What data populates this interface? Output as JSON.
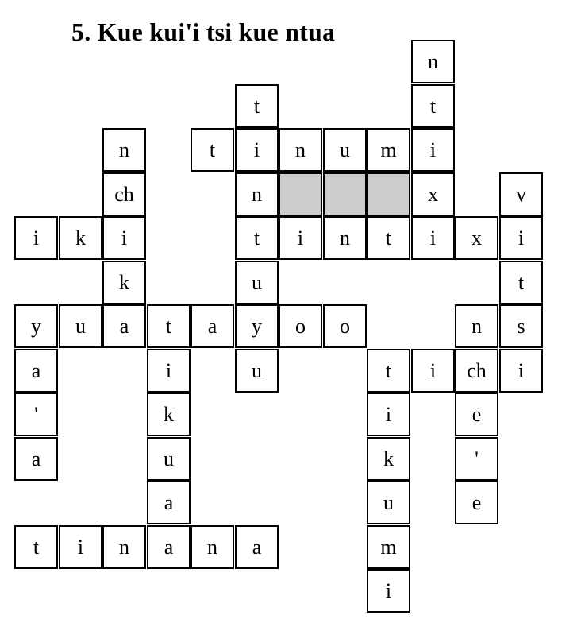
{
  "title": "5.  Kue kui'i tsi kue ntua",
  "colors": {
    "border": "#000000",
    "shaded_cell": "#cccccc",
    "background": "#ffffff"
  },
  "grid": {
    "rows": 13,
    "cols": 12,
    "cells": [
      {
        "r": 0,
        "c": 9,
        "letter": "n"
      },
      {
        "r": 1,
        "c": 5,
        "letter": "t"
      },
      {
        "r": 1,
        "c": 9,
        "letter": "t"
      },
      {
        "r": 2,
        "c": 2,
        "letter": "n"
      },
      {
        "r": 2,
        "c": 4,
        "letter": "t"
      },
      {
        "r": 2,
        "c": 5,
        "letter": "i"
      },
      {
        "r": 2,
        "c": 6,
        "letter": "n"
      },
      {
        "r": 2,
        "c": 7,
        "letter": "u"
      },
      {
        "r": 2,
        "c": 8,
        "letter": "m"
      },
      {
        "r": 2,
        "c": 9,
        "letter": "i"
      },
      {
        "r": 3,
        "c": 2,
        "letter": "ch"
      },
      {
        "r": 3,
        "c": 5,
        "letter": "n"
      },
      {
        "r": 3,
        "c": 6,
        "letter": "",
        "shaded": true
      },
      {
        "r": 3,
        "c": 7,
        "letter": "",
        "shaded": true
      },
      {
        "r": 3,
        "c": 8,
        "letter": "",
        "shaded": true
      },
      {
        "r": 3,
        "c": 9,
        "letter": "x"
      },
      {
        "r": 3,
        "c": 11,
        "letter": "v"
      },
      {
        "r": 4,
        "c": 0,
        "letter": "i"
      },
      {
        "r": 4,
        "c": 1,
        "letter": "k"
      },
      {
        "r": 4,
        "c": 2,
        "letter": "i"
      },
      {
        "r": 4,
        "c": 5,
        "letter": "t"
      },
      {
        "r": 4,
        "c": 6,
        "letter": "i"
      },
      {
        "r": 4,
        "c": 7,
        "letter": "n"
      },
      {
        "r": 4,
        "c": 8,
        "letter": "t"
      },
      {
        "r": 4,
        "c": 9,
        "letter": "i"
      },
      {
        "r": 4,
        "c": 10,
        "letter": "x"
      },
      {
        "r": 4,
        "c": 11,
        "letter": "i"
      },
      {
        "r": 5,
        "c": 2,
        "letter": "k"
      },
      {
        "r": 5,
        "c": 5,
        "letter": "u"
      },
      {
        "r": 5,
        "c": 11,
        "letter": "t"
      },
      {
        "r": 6,
        "c": 0,
        "letter": "y"
      },
      {
        "r": 6,
        "c": 1,
        "letter": "u"
      },
      {
        "r": 6,
        "c": 2,
        "letter": "a"
      },
      {
        "r": 6,
        "c": 3,
        "letter": "t"
      },
      {
        "r": 6,
        "c": 4,
        "letter": "a"
      },
      {
        "r": 6,
        "c": 5,
        "letter": "y"
      },
      {
        "r": 6,
        "c": 6,
        "letter": "o"
      },
      {
        "r": 6,
        "c": 7,
        "letter": "o"
      },
      {
        "r": 6,
        "c": 10,
        "letter": "n"
      },
      {
        "r": 6,
        "c": 11,
        "letter": "s"
      },
      {
        "r": 7,
        "c": 0,
        "letter": "a"
      },
      {
        "r": 7,
        "c": 3,
        "letter": "i"
      },
      {
        "r": 7,
        "c": 5,
        "letter": "u"
      },
      {
        "r": 7,
        "c": 8,
        "letter": "t"
      },
      {
        "r": 7,
        "c": 9,
        "letter": "i"
      },
      {
        "r": 7,
        "c": 10,
        "letter": "ch"
      },
      {
        "r": 7,
        "c": 11,
        "letter": "i"
      },
      {
        "r": 8,
        "c": 0,
        "letter": "'"
      },
      {
        "r": 8,
        "c": 3,
        "letter": "k"
      },
      {
        "r": 8,
        "c": 8,
        "letter": "i"
      },
      {
        "r": 8,
        "c": 10,
        "letter": "e"
      },
      {
        "r": 9,
        "c": 0,
        "letter": "a"
      },
      {
        "r": 9,
        "c": 3,
        "letter": "u"
      },
      {
        "r": 9,
        "c": 8,
        "letter": "k"
      },
      {
        "r": 9,
        "c": 10,
        "letter": "'"
      },
      {
        "r": 10,
        "c": 3,
        "letter": "a"
      },
      {
        "r": 10,
        "c": 8,
        "letter": "u"
      },
      {
        "r": 10,
        "c": 10,
        "letter": "e"
      },
      {
        "r": 11,
        "c": 0,
        "letter": "t"
      },
      {
        "r": 11,
        "c": 1,
        "letter": "i"
      },
      {
        "r": 11,
        "c": 2,
        "letter": "n"
      },
      {
        "r": 11,
        "c": 3,
        "letter": "a"
      },
      {
        "r": 11,
        "c": 4,
        "letter": "n"
      },
      {
        "r": 11,
        "c": 5,
        "letter": "a"
      },
      {
        "r": 11,
        "c": 8,
        "letter": "m"
      },
      {
        "r": 12,
        "c": 8,
        "letter": "i"
      }
    ]
  }
}
